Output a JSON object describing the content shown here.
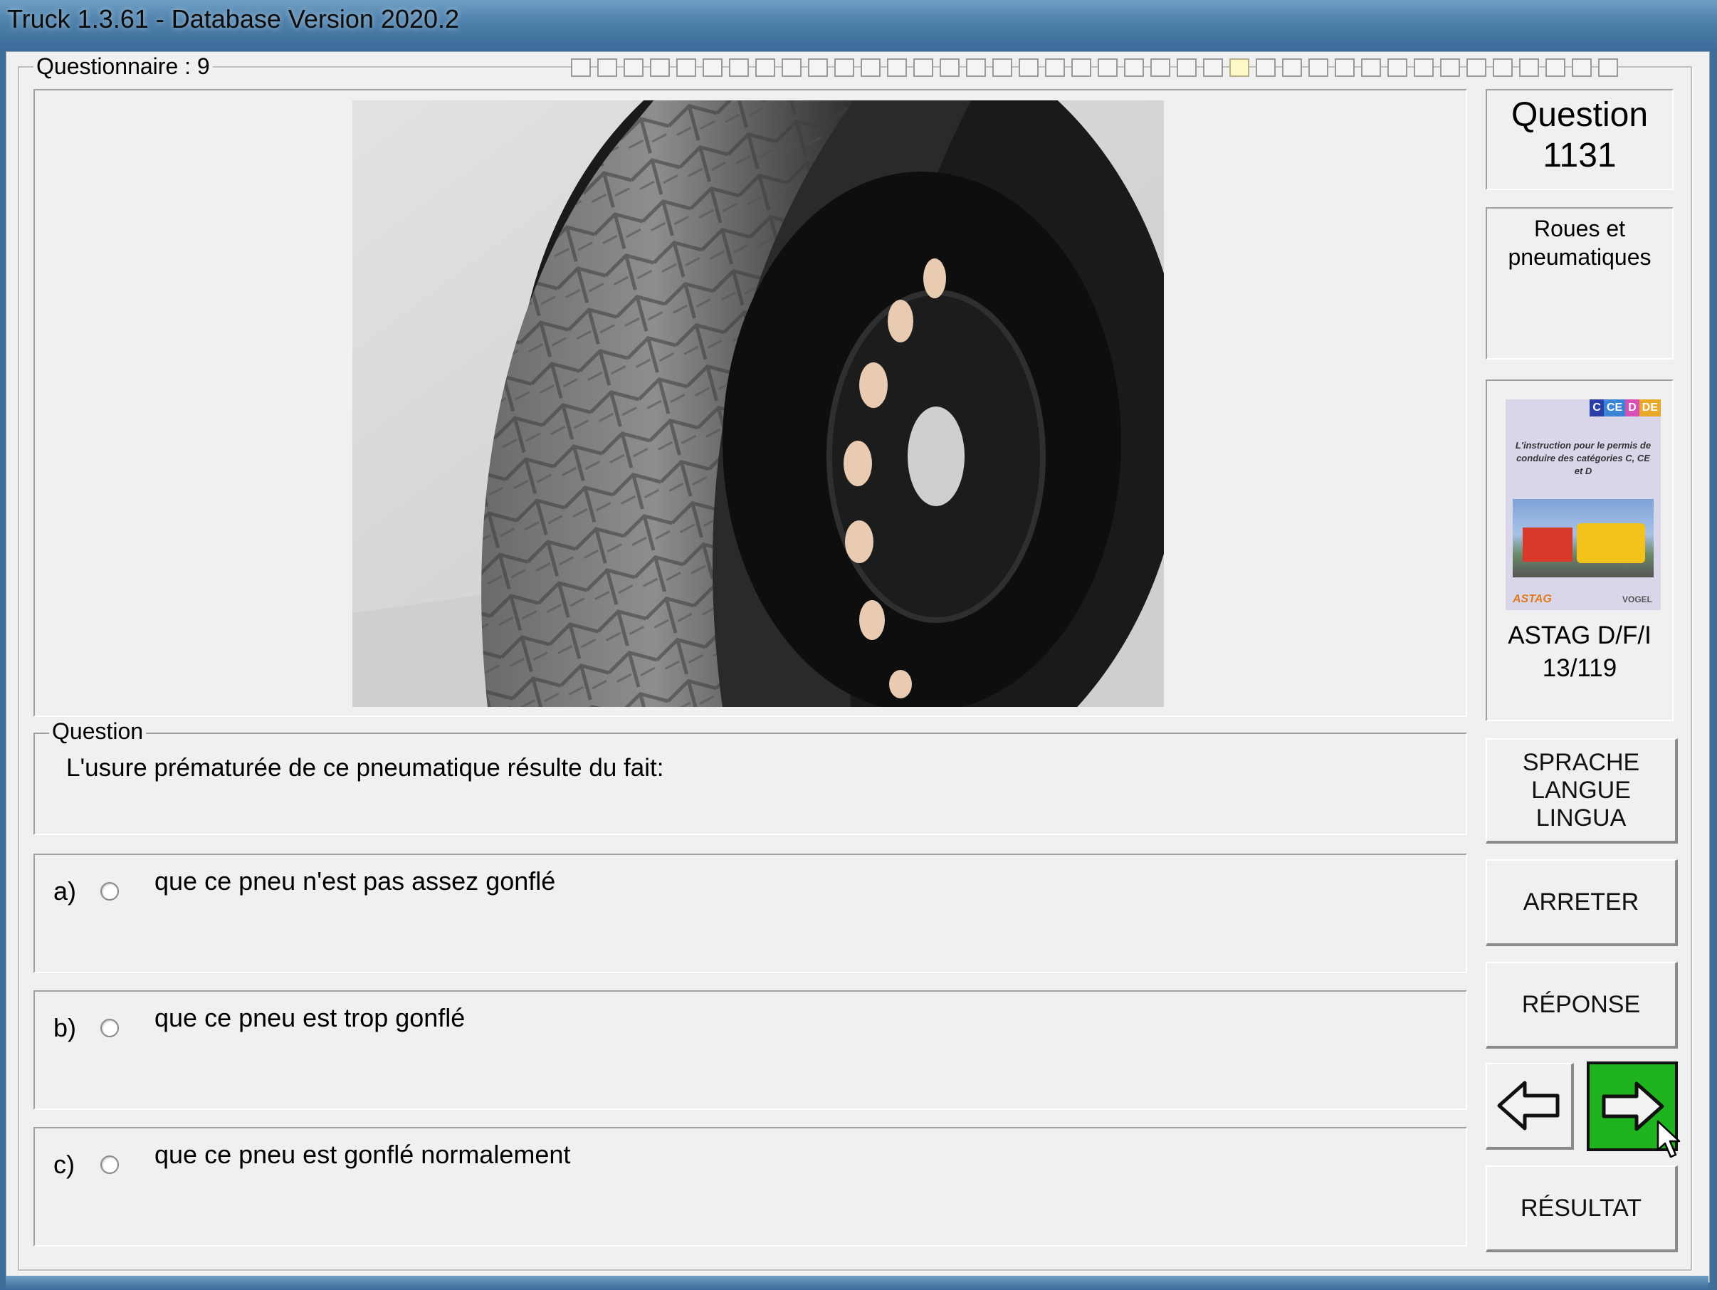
{
  "window": {
    "title": "Truck 1.3.61 - Database Version 2020.2"
  },
  "questionnaire": {
    "legend": "Questionnaire : 9",
    "progress_total": 40,
    "progress_current": 26
  },
  "question_panel": {
    "title_line1": "Question",
    "number": "1131",
    "category": "Roues et pneumatiques"
  },
  "book": {
    "badges": [
      "C",
      "CE",
      "D",
      "DE"
    ],
    "cover_text": "L'instruction pour le permis de conduire des catégories C, CE et D",
    "publisher_left": "ASTAG",
    "publisher_right": "VOGEL",
    "source": "ASTAG D/F/I",
    "reference": "13/119"
  },
  "question": {
    "legend": "Question",
    "text": "L'usure prématurée de ce pneumatique résulte du fait:"
  },
  "answers": [
    {
      "letter": "a)",
      "text": "que ce pneu n'est pas assez gonflé"
    },
    {
      "letter": "b)",
      "text": "que ce pneu est trop gonflé"
    },
    {
      "letter": "c)",
      "text": "que ce pneu est gonflé normalement"
    }
  ],
  "buttons": {
    "language": "SPRACHE\nLANGUE\nLINGUA",
    "stop": "ARRETER",
    "answer": "RÉPONSE",
    "result": "RÉSULTAT"
  },
  "colors": {
    "next_button": "#1fb31f",
    "window_bg": "#f0f0f0"
  }
}
